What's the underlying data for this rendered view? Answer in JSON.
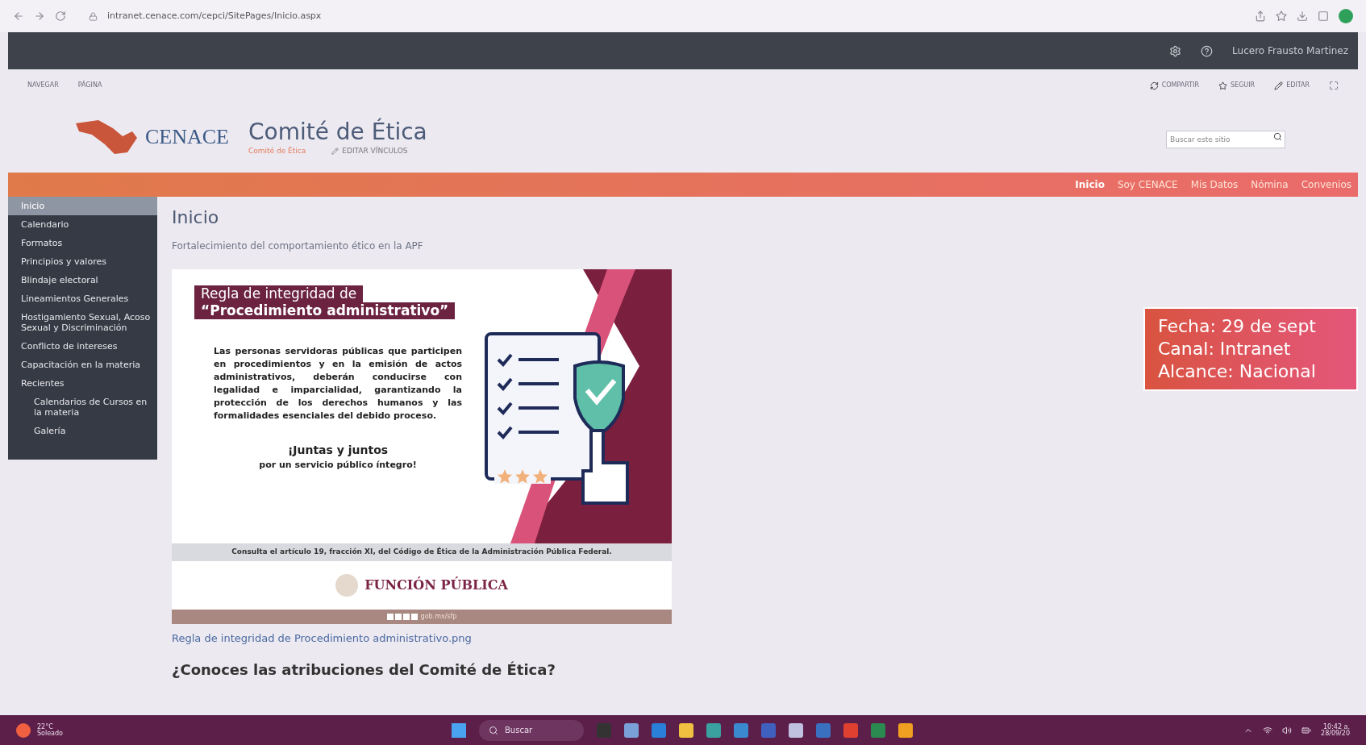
{
  "browser": {
    "url": "intranet.cenace.com/cepci/SitePages/Inicio.aspx"
  },
  "suite_bar": {
    "user": "Lucero Frausto Martinez"
  },
  "ribbon": {
    "tabs": [
      "NAVEGAR",
      "PÁGINA"
    ],
    "actions": [
      "COMPARTIR",
      "SEGUIR",
      "EDITAR"
    ]
  },
  "header": {
    "logo_text": "CENACE",
    "site_title": "Comité de Ética",
    "breadcrumb": "Comité de Ética",
    "edit_links": "EDITAR VÍNCULOS",
    "search": {
      "placeholder": "Buscar este sitio"
    }
  },
  "top_nav": [
    {
      "label": "Inicio",
      "selected": true
    },
    {
      "label": "Soy CENACE",
      "selected": false
    },
    {
      "label": "Mis Datos",
      "selected": false
    },
    {
      "label": "Nómina",
      "selected": false
    },
    {
      "label": "Convenios",
      "selected": false
    }
  ],
  "sidebar": {
    "items": [
      {
        "label": "Inicio",
        "selected": true
      },
      {
        "label": "Calendario",
        "selected": false
      },
      {
        "label": "Formatos",
        "selected": false
      },
      {
        "label": "Principios y valores",
        "selected": false
      },
      {
        "label": "Blindaje electoral",
        "selected": false
      },
      {
        "label": "Lineamientos Generales",
        "selected": false
      },
      {
        "label": "Hostigamiento Sexual, Acoso Sexual y Discriminación",
        "selected": false
      },
      {
        "label": "Conflicto de intereses",
        "selected": false
      },
      {
        "label": "Capacitación en la materia",
        "selected": false
      },
      {
        "label": "Recientes",
        "selected": false,
        "children": [
          {
            "label": "Calendarios de Cursos en la materia",
            "selected": false
          },
          {
            "label": "Galería",
            "selected": false
          }
        ]
      }
    ]
  },
  "content": {
    "title": "Inicio",
    "subtitle": "Fortalecimiento del comportamiento ético en la APF",
    "poster": {
      "title_line1": "Regla de integridad de",
      "title_line2": "“Procedimiento administrativo”",
      "body": "Las personas servidoras públicas que participen en procedimientos y en la emisión de actos administrativos, deberán conducirse con legalidad e imparcialidad, garantizando la protección de los derechos humanos y las formalidades esenciales del debido proceso.",
      "slogan_line1": "¡Juntas y juntos",
      "slogan_line2": "por un servicio público íntegro!",
      "footnote": "Consulta el artículo 19, fracción XI, del Código de Ética de la Administración Pública Federal.",
      "brand": "FUNCIÓN PÚBLICA",
      "web": "gob.mx/sfp",
      "stars": 3
    },
    "caption": "Regla de integridad de Procedimiento administrativo.png",
    "next_heading": "¿Conoces las atribuciones del Comité de Ética?"
  },
  "info_box": {
    "lines": [
      "Fecha: 29 de sept",
      "Canal: Intranet",
      "Alcance: Nacional"
    ]
  },
  "taskbar": {
    "weather": {
      "temp": "22°C",
      "condition": "Soleado"
    },
    "search": {
      "placeholder": "Buscar"
    },
    "time": "10:42 a.",
    "date": "28/09/20"
  }
}
